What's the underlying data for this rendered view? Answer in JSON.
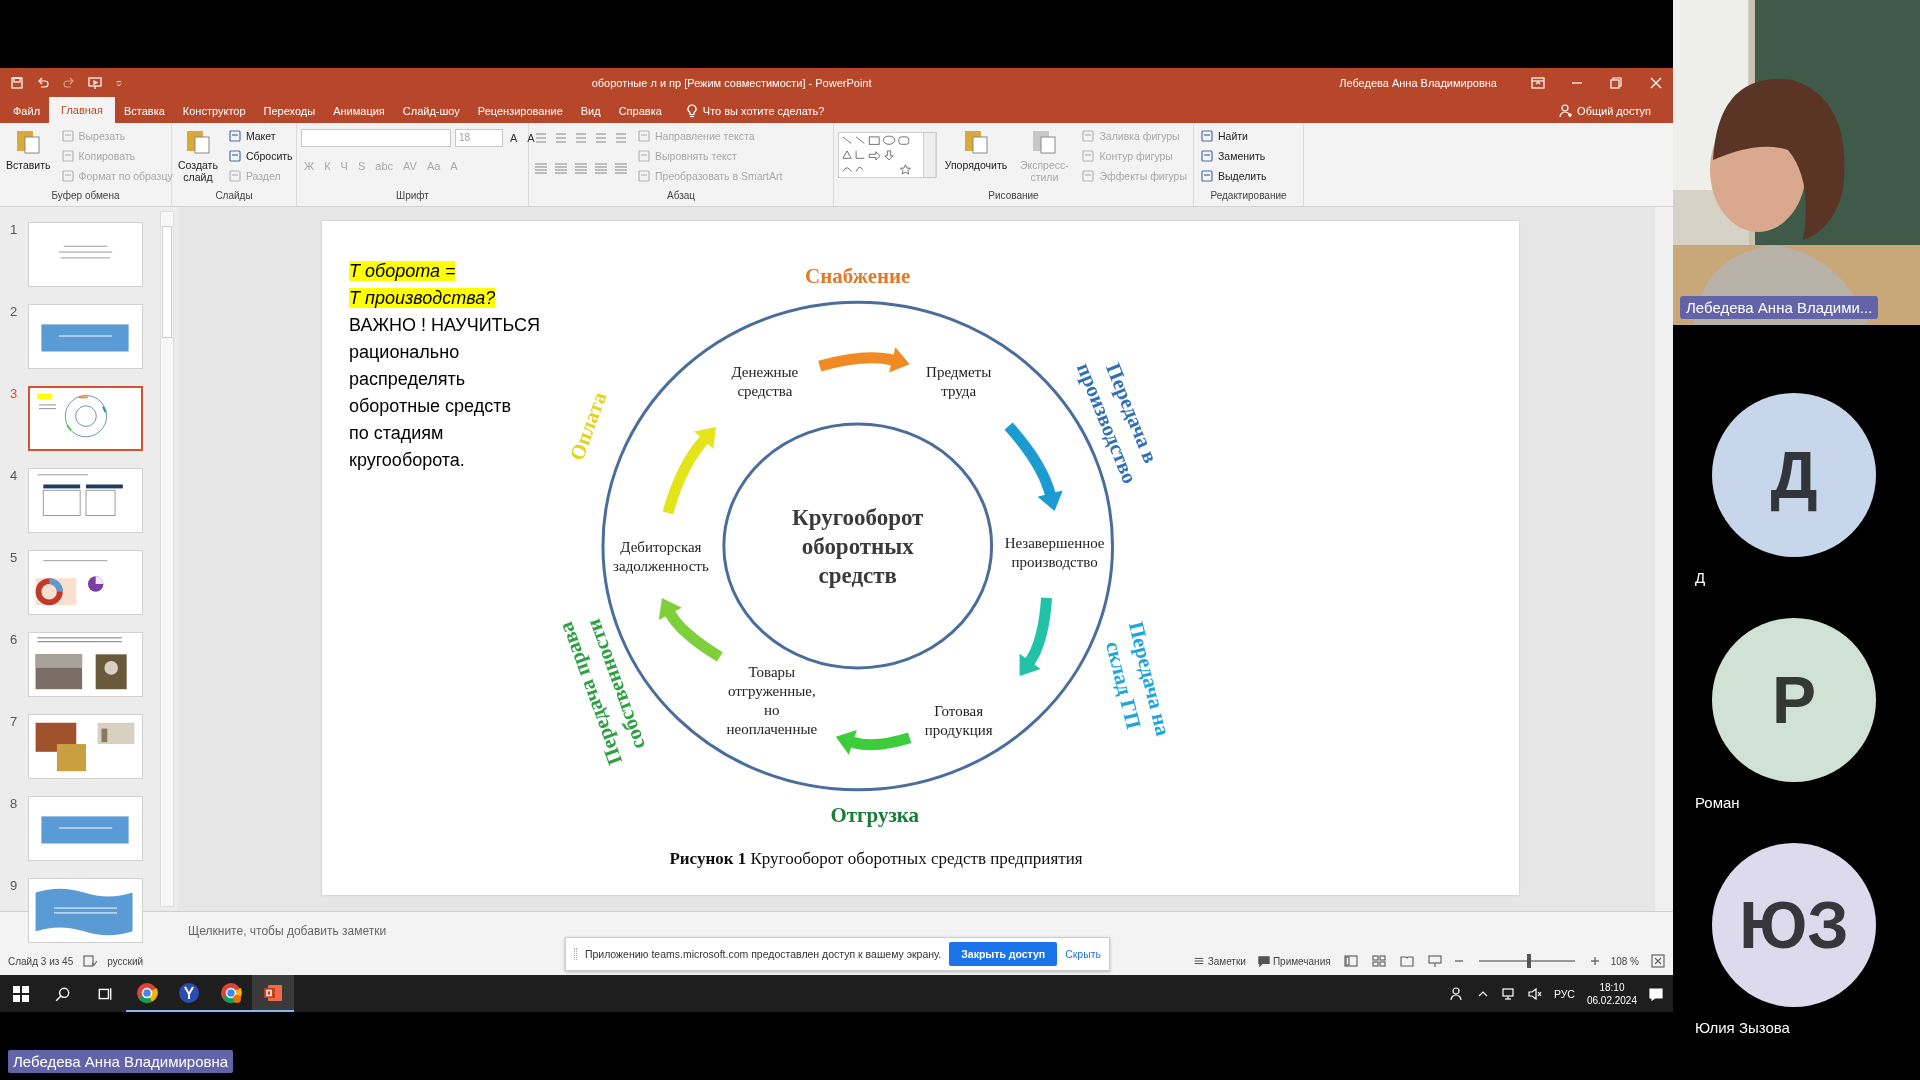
{
  "titlebar": {
    "title": "оборотные л и пр [Режим совместимости]  -  PowerPoint",
    "user": "Лебедева Анна Владимировна"
  },
  "tabs": [
    {
      "label": "Файл",
      "selected": false
    },
    {
      "label": "Главная",
      "selected": true
    },
    {
      "label": "Вставка",
      "selected": false
    },
    {
      "label": "Конструктор",
      "selected": false
    },
    {
      "label": "Переходы",
      "selected": false
    },
    {
      "label": "Анимация",
      "selected": false
    },
    {
      "label": "Слайд-шоу",
      "selected": false
    },
    {
      "label": "Рецензирование",
      "selected": false
    },
    {
      "label": "Вид",
      "selected": false
    },
    {
      "label": "Справка",
      "selected": false
    }
  ],
  "tell_me": "Что вы хотите сделать?",
  "share": "Общий доступ",
  "ribbon": [
    {
      "label": "Буфер обмена",
      "items": [
        {
          "kind": "big",
          "label": "Вставить",
          "disabled": false
        },
        {
          "kind": "small",
          "label": "Вырезать",
          "disabled": true
        },
        {
          "kind": "small",
          "label": "Копировать",
          "disabled": true
        },
        {
          "kind": "small",
          "label": "Формат по образцу",
          "disabled": true
        }
      ]
    },
    {
      "label": "Слайды",
      "items": [
        {
          "kind": "big",
          "label": "Создать слайд",
          "disabled": false
        },
        {
          "kind": "small",
          "label": "Макет",
          "disabled": false
        },
        {
          "kind": "small",
          "label": "Сбросить",
          "disabled": false
        },
        {
          "kind": "small",
          "label": "Раздел",
          "disabled": true
        }
      ]
    },
    {
      "label": "Шрифт",
      "items": [
        {
          "kind": "font-field"
        },
        {
          "kind": "size-field",
          "value": "18"
        },
        {
          "kind": "glyph",
          "label": "A",
          "disabled": false
        },
        {
          "kind": "glyph",
          "label": "A",
          "disabled": false
        },
        {
          "kind": "glyph",
          "label": "Ж",
          "disabled": true
        },
        {
          "kind": "glyph",
          "label": "К",
          "disabled": true
        },
        {
          "kind": "glyph",
          "label": "Ч",
          "disabled": true
        },
        {
          "kind": "glyph",
          "label": "S",
          "disabled": true
        },
        {
          "kind": "glyph",
          "label": "abc",
          "disabled": true
        },
        {
          "kind": "glyph",
          "label": "AV",
          "disabled": true
        },
        {
          "kind": "glyph",
          "label": "Aa",
          "disabled": true
        },
        {
          "kind": "glyph",
          "label": "A",
          "disabled": true
        }
      ]
    },
    {
      "label": "Абзац",
      "items": [
        {
          "kind": "list-buttons"
        },
        {
          "kind": "small",
          "label": "Направление текста",
          "disabled": true
        },
        {
          "kind": "small",
          "label": "Выровнять текст",
          "disabled": true
        },
        {
          "kind": "small",
          "label": "Преобразовать в SmartArt",
          "disabled": true
        }
      ]
    },
    {
      "label": "Рисование",
      "items": [
        {
          "kind": "gallery"
        },
        {
          "kind": "big",
          "label": "Упорядочить",
          "disabled": false
        },
        {
          "kind": "big",
          "label": "Экспресс-стили",
          "disabled": true
        },
        {
          "kind": "small",
          "label": "Заливка фигуры",
          "disabled": true
        },
        {
          "kind": "small",
          "label": "Контур фигуры",
          "disabled": true
        },
        {
          "kind": "small",
          "label": "Эффекты фигуры",
          "disabled": true
        }
      ]
    },
    {
      "label": "Редактирование",
      "items": [
        {
          "kind": "small",
          "label": "Найти",
          "disabled": false
        },
        {
          "kind": "small",
          "label": "Заменить",
          "disabled": false
        },
        {
          "kind": "small",
          "label": "Выделить",
          "disabled": false
        }
      ]
    }
  ],
  "thumbnails": [
    {
      "number": "1",
      "kind": "title",
      "selected": false
    },
    {
      "number": "2",
      "kind": "blue-box",
      "selected": false
    },
    {
      "number": "3",
      "kind": "diagram",
      "selected": true
    },
    {
      "number": "4",
      "kind": "table",
      "selected": false
    },
    {
      "number": "5",
      "kind": "chart",
      "selected": false
    },
    {
      "number": "6",
      "kind": "photos",
      "selected": false
    },
    {
      "number": "7",
      "kind": "collage",
      "selected": false
    },
    {
      "number": "8",
      "kind": "blue-box",
      "selected": false
    },
    {
      "number": "9",
      "kind": "wave",
      "selected": false
    }
  ],
  "slide": {
    "paragraphs": [
      {
        "highlighted": true,
        "lines": [
          "Т оборота =",
          "Т производства?"
        ]
      },
      {
        "highlighted": false,
        "lines": [
          "ВАЖНО ! НАУЧИТЬСЯ",
          "рационально",
          "распределять",
          "оборотные средств",
          "по стадиям",
          "кругооборота."
        ]
      }
    ],
    "diagram": {
      "center": [
        "Кругооборот",
        "оборотных",
        "средств"
      ],
      "nodes": [
        {
          "lines": [
            "Денежные",
            "средства"
          ]
        },
        {
          "lines": [
            "Предметы",
            "труда"
          ]
        },
        {
          "lines": [
            "Дебиторская",
            "задолженность"
          ]
        },
        {
          "lines": [
            "Незавершенное",
            "производство"
          ]
        },
        {
          "lines": [
            "Товары",
            "отгруженные,",
            "но",
            "неоплаченные"
          ]
        },
        {
          "lines": [
            "Готовая",
            "продукция"
          ]
        }
      ],
      "arrows": [
        {
          "color": "#f08a24"
        },
        {
          "color": "#1c9bd0"
        },
        {
          "color": "#22c2a8"
        },
        {
          "color": "#3ccc3c"
        },
        {
          "color": "#7ed03a"
        },
        {
          "color": "#e4e41a"
        }
      ],
      "phases": [
        {
          "lines": [
            "Снабжение"
          ],
          "color": "#e2792a"
        },
        {
          "lines": [
            "Передача в",
            "производство"
          ],
          "color": "#2f6fb5"
        },
        {
          "lines": [
            "Передача на",
            "склад ГП"
          ],
          "color": "#1ea6dc"
        },
        {
          "lines": [
            "Отгрузка"
          ],
          "color": "#1c7a3a"
        },
        {
          "lines": [
            "Передача права",
            "собственности"
          ],
          "color": "#2ea043"
        },
        {
          "lines": [
            "Оплата"
          ],
          "color": "#e3d31c"
        }
      ]
    },
    "caption": "**Рисунок 1** Кругооборот оборотных средств предприятия"
  },
  "notes_placeholder": "Щелкните, чтобы добавить заметки",
  "status_bar": {
    "slide": "Слайд 3 из 45",
    "language": "русский",
    "notes": "Заметки",
    "comments": "Примечания",
    "zoom": "108 %",
    "level": 0.52
  },
  "share_notice": {
    "text": "Приложению teams.microsoft.com предоставлен доступ к вашему экрану.",
    "stop": "Закрыть доступ",
    "hide": "Скрыть"
  },
  "taskbar": {
    "language": "РУС",
    "time": "18:10",
    "date": "06.02.2024"
  },
  "presenter_badge": "Лебедева Анна Владимировна",
  "video": {
    "kind": "picture",
    "name": "Лебедева Анна Владими..."
  },
  "participants": [
    {
      "initials": "Д",
      "name": "Д",
      "color": "#c8d6eb"
    },
    {
      "initials": "Р",
      "name": "Роман",
      "color": "#cfe2d5"
    },
    {
      "initials": "ЮЗ",
      "name": "Юлия Зызова",
      "color": "#dddaed"
    }
  ]
}
